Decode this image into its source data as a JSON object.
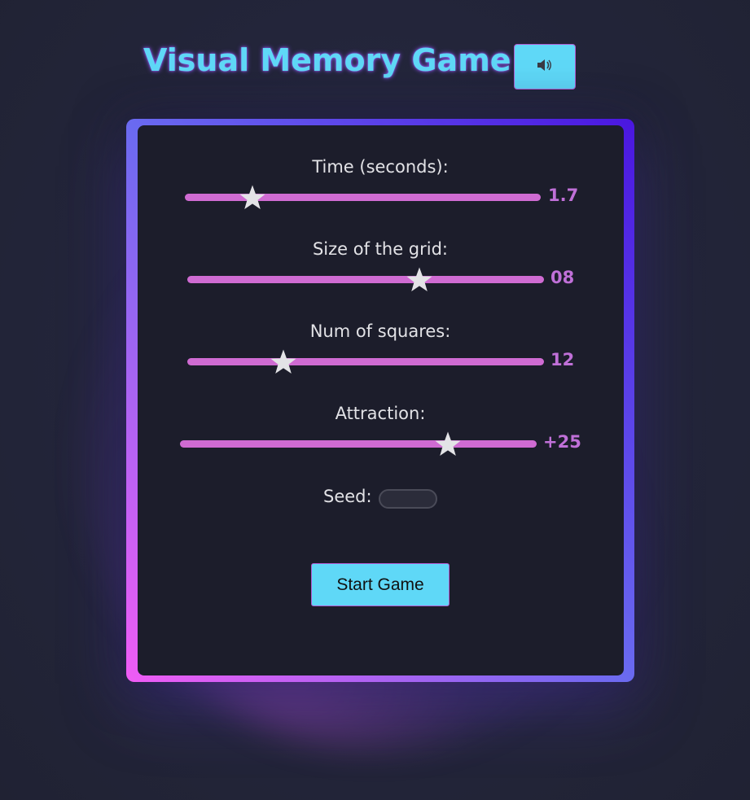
{
  "app": {
    "title": "Visual Memory Game",
    "sound_button_icon": "speaker-icon"
  },
  "settings": {
    "time": {
      "label": "Time (seconds):",
      "value": 0.19,
      "display": "1.7"
    },
    "grid_size": {
      "label": "Size of the grid:",
      "value": 0.65,
      "display": "08"
    },
    "num_squares": {
      "label": "Num of squares:",
      "value": 0.27,
      "display": "12"
    },
    "attraction": {
      "label": "Attraction:",
      "value": 0.75,
      "display": "+25"
    },
    "seed": {
      "label": "Seed:",
      "value": ""
    }
  },
  "actions": {
    "start_label": "Start Game"
  },
  "colors": {
    "accent_cyan": "#5fd8f7",
    "slider_track": "#cf6bd2",
    "value_text": "#c070d8",
    "card_background": "#1c1d2b",
    "page_background": "#22243a"
  }
}
